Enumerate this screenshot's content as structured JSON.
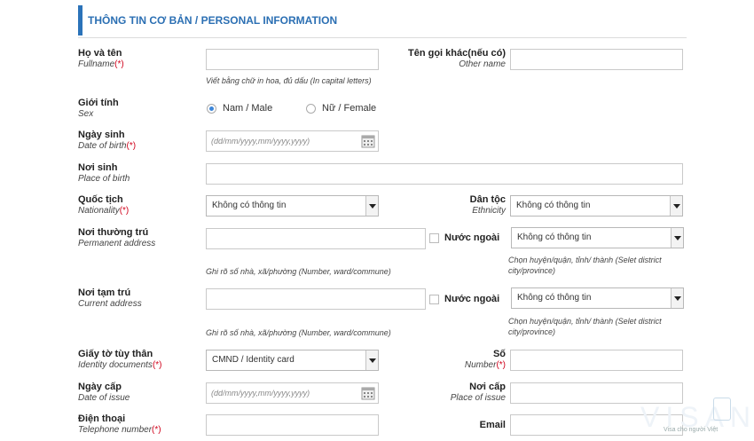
{
  "header": {
    "title": "THÔNG TIN CƠ BẢN / PERSONAL INFORMATION"
  },
  "fullname": {
    "label": "Họ và tên",
    "sub": "Fullname",
    "req": "(*)",
    "hint": "Viết bằng chữ in hoa, đủ dấu (In capital letters)"
  },
  "other_name": {
    "label": "Tên gọi khác(nếu có)",
    "sub": "Other name"
  },
  "sex": {
    "label": "Giới tính",
    "sub": "Sex",
    "options": [
      "Nam / Male",
      "Nữ / Female"
    ],
    "selected": "Nam / Male"
  },
  "dob": {
    "label": "Ngày sinh",
    "sub": "Date of birth",
    "req": "(*)",
    "placeholder": "(dd/mm/yyyy,mm/yyyy,yyyy)"
  },
  "pob": {
    "label": "Nơi sinh",
    "sub": "Place of birth"
  },
  "nationality": {
    "label": "Quốc tịch",
    "sub": "Nationality",
    "req": "(*)",
    "value": "Không có thông tin"
  },
  "ethnicity": {
    "label": "Dân tộc",
    "sub": "Ethnicity",
    "value": "Không có thông tin"
  },
  "permanent": {
    "label": "Nơi thường trú",
    "sub": "Permanent address",
    "hint": "Ghi rõ số nhà, xã/phường (Number, ward/commune)",
    "abroad_label": "Nước ngoài",
    "select_value": "Không có thông tin",
    "select_hint_1": "Chọn huyện/quận, tỉnh/ thành (Selet district",
    "select_hint_2": "city/province)"
  },
  "current": {
    "label": "Nơi tạm trú",
    "sub": "Current address",
    "hint": "Ghi rõ số nhà, xã/phường (Number, ward/commune)",
    "abroad_label": "Nước ngoài",
    "select_value": "Không có thông tin",
    "select_hint_1": "Chọn huyện/quận, tỉnh/ thành (Selet district",
    "select_hint_2": "city/province)"
  },
  "identity": {
    "label": "Giấy tờ tùy thân",
    "sub": "Identity documents",
    "req": "(*)",
    "value": "CMND / Identity card"
  },
  "number": {
    "label": "Số",
    "sub": "Number",
    "req": "(*)"
  },
  "date_issue": {
    "label": "Ngày cấp",
    "sub": "Date of issue",
    "placeholder": "(dd/mm/yyyy,mm/yyyy,yyyy)"
  },
  "place_issue": {
    "label": "Nơi cấp",
    "sub": "Place of issue"
  },
  "phone": {
    "label": "Điện thoại",
    "sub": "Telephone number",
    "req": "(*)"
  },
  "email": {
    "label": "Email"
  },
  "watermark": {
    "brand": "VISANA",
    "tagline": "Visa cho người Việt"
  },
  "colors": {
    "accent": "#2b73b9",
    "required": "#d0021b",
    "radio_on": "#3d86d9"
  }
}
